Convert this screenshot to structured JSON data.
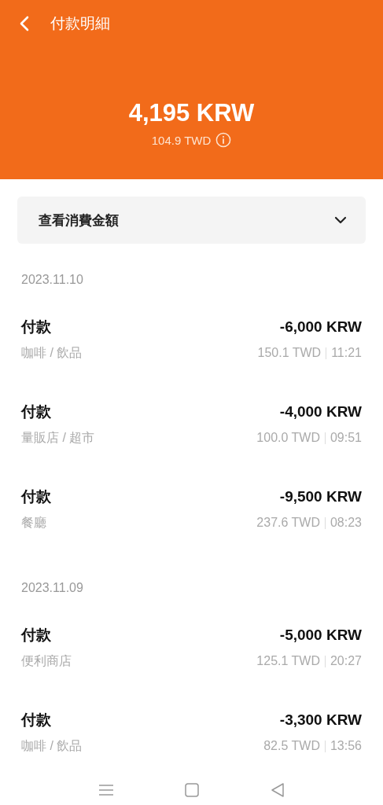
{
  "header": {
    "title": "付款明細",
    "amount": "4,195 KRW",
    "converted": "104.9 TWD"
  },
  "filter": {
    "label": "查看消費金額",
    "expanded": false
  },
  "groups": [
    {
      "date": "2023.11.10",
      "transactions": [
        {
          "title": "付款",
          "category": "咖啡 / 飲品",
          "amount": "-6,000 KRW",
          "converted": "150.1 TWD",
          "time": "11:21"
        },
        {
          "title": "付款",
          "category": "量販店 / 超市",
          "amount": "-4,000 KRW",
          "converted": "100.0 TWD",
          "time": "09:51"
        },
        {
          "title": "付款",
          "category": "餐廳",
          "amount": "-9,500 KRW",
          "converted": "237.6 TWD",
          "time": "08:23"
        }
      ]
    },
    {
      "date": "2023.11.09",
      "transactions": [
        {
          "title": "付款",
          "category": "便利商店",
          "amount": "-5,000 KRW",
          "converted": "125.1 TWD",
          "time": "20:27"
        },
        {
          "title": "付款",
          "category": "咖啡 / 飲品",
          "amount": "-3,300 KRW",
          "converted": "82.5 TWD",
          "time": "13:56"
        }
      ]
    }
  ]
}
